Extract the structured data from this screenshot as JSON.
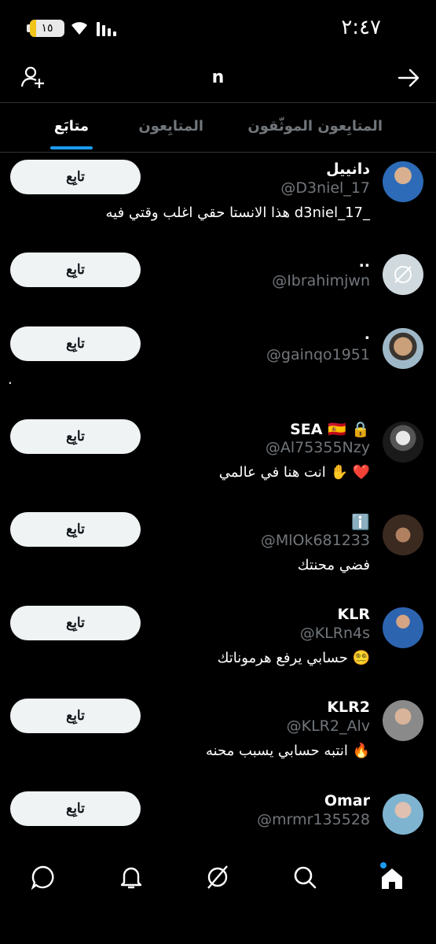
{
  "status": {
    "time": "٢:٤٧",
    "battery": "١٥"
  },
  "header": {
    "title": "n"
  },
  "tabs": [
    {
      "label": "المتابِعون الموثّقون"
    },
    {
      "label": "المتابِعون"
    },
    {
      "label": "متابَع"
    }
  ],
  "follow_label": "تابِع",
  "users": [
    {
      "name": "دانييل",
      "handle": "@D3niel_17",
      "bio": "هذا الانستا حقي اغلب وقتي فيه d3niel_17_"
    },
    {
      "name": "..",
      "handle": "@Ibrahimjwn",
      "bio": ""
    },
    {
      "name": ".",
      "handle": "@gainqo1951",
      "bio": "."
    },
    {
      "name": "SEA 🇪🇸 🔒",
      "handle": "@Al75355Nzy",
      "bio": "انت هنا في عالمي ✋ ❤️"
    },
    {
      "name": "ℹ️",
      "handle": "@MlOk681233",
      "bio": "فضي محنتك"
    },
    {
      "name": "KLR",
      "handle": "@KLRn4s",
      "bio": "حسابي يرفع هرموناتك 😵‍💫"
    },
    {
      "name": "KLR2",
      "handle": "@KLR2_Alv",
      "bio": "انتبه حسابي يسبب محنه 🔥"
    },
    {
      "name": "Omar",
      "handle": "@mrmr135528",
      "bio": ""
    }
  ],
  "colors": {
    "accent": "#1d9bf0",
    "muted": "#71767b",
    "button_bg": "#eff3f4"
  }
}
